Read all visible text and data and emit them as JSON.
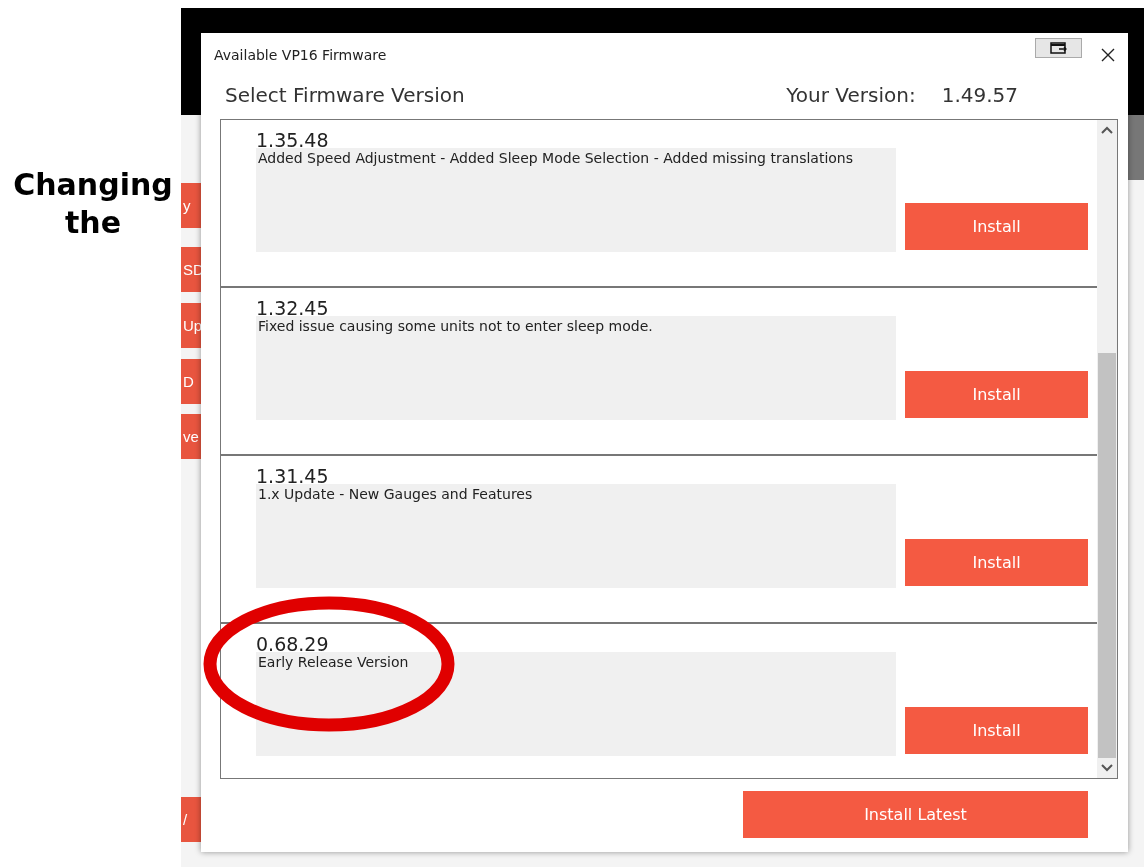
{
  "caption": "Changing the",
  "background_app": {
    "buttons": [
      "y",
      "SD",
      "Up",
      "D",
      "ve",
      "/"
    ]
  },
  "dialog": {
    "title": "Available VP16 Firmware",
    "heading": "Select Firmware Version",
    "your_version_label": "Your Version:",
    "your_version": "1.49.57",
    "firmwares": [
      {
        "version": "1.35.48",
        "notes": "Added Speed Adjustment - Added Sleep Mode Selection - Added missing translations",
        "button": "Install",
        "highlighted": false
      },
      {
        "version": "1.32.45",
        "notes": "Fixed issue causing some units not to enter sleep mode.",
        "button": "Install",
        "highlighted": false
      },
      {
        "version": "1.31.45",
        "notes": "1.x Update - New Gauges and Features",
        "button": "Install",
        "highlighted": false
      },
      {
        "version": "0.68.29",
        "notes": "Early Release Version",
        "button": "Install",
        "highlighted": true
      }
    ],
    "install_latest": "Install Latest"
  }
}
